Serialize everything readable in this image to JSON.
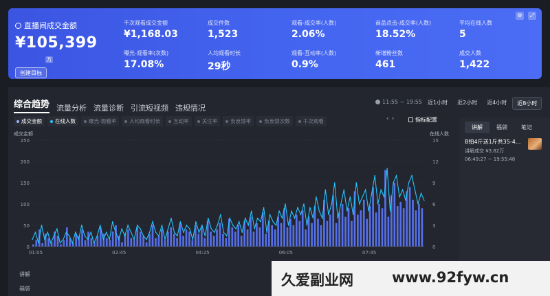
{
  "stats": {
    "icons": [
      "settings-icon",
      "expand-icon"
    ],
    "gmv_title": "直播间成交金额",
    "gmv_value": "¥105,399",
    "gmv_unit": "万",
    "target_button": "创建目标",
    "metrics": [
      {
        "label": "千次观看成交金额",
        "value": "¥1,168.03"
      },
      {
        "label": "成交件数",
        "value": "1,523"
      },
      {
        "label": "观看-成交率(人数)",
        "value": "2.06%"
      },
      {
        "label": "商品点击-成交率(人数)",
        "value": "18.52%"
      },
      {
        "label": "平均在线人数",
        "value": "5"
      },
      {
        "label": "曝光-观看率(次数)",
        "value": "17.08%"
      },
      {
        "label": "人均观看时长",
        "value": "29秒"
      },
      {
        "label": "观看-互动率(人数)",
        "value": "0.9%"
      },
      {
        "label": "新增粉丝数",
        "value": "461"
      },
      {
        "label": "成交人数",
        "value": "1,422"
      }
    ]
  },
  "tabs": [
    {
      "label": "综合趋势",
      "active": true
    },
    {
      "label": "流量分析"
    },
    {
      "label": "流量诊断"
    },
    {
      "label": "引流短视频"
    },
    {
      "label": "违规情况"
    }
  ],
  "time_range": "11:55 ~ 19:55",
  "periods": [
    {
      "label": "近1小时"
    },
    {
      "label": "近2小时"
    },
    {
      "label": "近4小时"
    },
    {
      "label": "近8小时",
      "active": true
    }
  ],
  "legend": [
    {
      "label": "成交金额",
      "on": true,
      "color": "#7f96ff"
    },
    {
      "label": "在线人数",
      "on": true,
      "color": "#26c6ff"
    },
    {
      "label": "曝光-观看率"
    },
    {
      "label": "人均观看时长"
    },
    {
      "label": "互动率"
    },
    {
      "label": "关注率"
    },
    {
      "label": "负反馈率"
    },
    {
      "label": "负反馈次数"
    },
    {
      "label": "千次观看"
    }
  ],
  "nav_arrows": [
    "‹",
    "›"
  ],
  "config_button": "指标配置",
  "chart_data": {
    "type": "bar",
    "left_axis_title": "成交金额",
    "right_axis_title": "在线人数",
    "y_left_ticks": [
      0,
      50,
      100,
      150,
      200,
      250
    ],
    "y_right_ticks": [
      0,
      3,
      6,
      9,
      12,
      15
    ],
    "ylim_left": [
      0,
      250
    ],
    "ylim_right": [
      0,
      15
    ],
    "x_ticks": [
      "01:05",
      "02:45",
      "04:25",
      "06:05",
      "07:45"
    ],
    "series": [
      {
        "name": "成交金额",
        "color": "#5b79ff",
        "values": [
          5,
          15,
          40,
          8,
          30,
          20,
          10,
          35,
          25,
          5,
          15,
          45,
          20,
          10,
          30,
          25,
          40,
          15,
          35,
          20,
          10,
          25,
          45,
          30,
          20,
          15,
          35,
          50,
          25,
          10,
          30,
          40,
          20,
          15,
          45,
          35,
          25,
          10,
          30,
          50,
          20,
          25,
          40,
          15,
          35,
          45,
          30,
          20,
          55,
          25,
          40,
          35,
          15,
          50,
          30,
          45,
          20,
          60,
          35,
          25,
          40,
          55,
          30,
          20,
          65,
          45,
          35,
          50,
          25,
          60,
          40,
          70,
          35,
          55,
          45,
          80,
          30,
          60,
          50,
          40,
          70,
          55,
          90,
          45,
          65,
          50,
          75,
          60,
          85,
          40,
          70,
          55,
          95,
          65,
          50,
          110,
          60,
          75,
          120,
          55,
          80,
          100,
          70,
          90,
          60,
          130,
          75,
          85,
          110,
          65,
          95,
          140,
          80,
          100,
          90,
          180,
          70,
          120,
          150,
          95,
          105,
          90,
          130,
          140,
          110,
          85,
          100,
          90
        ]
      },
      {
        "name": "在线人数",
        "color": "#26c6ff",
        "values": [
          1,
          2,
          0.5,
          3,
          1,
          2,
          0.5,
          1.5,
          2.5,
          0.5,
          1,
          2,
          1.5,
          0.5,
          2,
          1,
          3,
          1.5,
          1,
          2,
          0.5,
          1.5,
          3,
          1,
          2,
          1,
          3.5,
          2,
          1,
          2.5,
          1.5,
          3,
          2,
          1,
          3,
          2.5,
          1.5,
          1,
          2,
          3.5,
          2,
          1.5,
          3,
          1,
          2.5,
          4,
          2,
          1.5,
          3.5,
          2,
          3,
          2.5,
          1,
          3.5,
          2,
          3,
          1.5,
          4,
          2.5,
          2,
          3,
          4.5,
          2,
          1.5,
          4,
          3,
          2.5,
          3.5,
          2,
          4,
          3,
          5,
          2.5,
          4,
          3.5,
          5.5,
          2,
          4.5,
          3.5,
          3,
          5,
          4,
          6,
          3,
          5,
          4,
          5.5,
          4.5,
          6,
          3,
          5.5,
          4,
          7,
          5,
          4,
          8,
          4.5,
          6,
          9,
          4,
          6,
          8,
          5,
          7,
          4.5,
          9,
          6,
          7,
          8,
          5,
          7.5,
          10,
          6,
          8,
          7,
          11,
          5,
          9,
          10,
          7,
          8,
          6.5,
          9,
          10,
          8,
          6,
          7.5,
          6.5
        ]
      }
    ]
  },
  "side_panel": {
    "tabs": [
      {
        "label": "讲解",
        "active": true
      },
      {
        "label": "福袋"
      },
      {
        "label": "笔记"
      }
    ],
    "product_name": "B拍4斤送1斤共35-4...",
    "product_deal": "讲解成交 ¥3.82万",
    "product_time": "06:49:27 ~ 19:55:48"
  },
  "bottom_rows": [
    "讲解",
    "福袋"
  ],
  "watermark": {
    "left": "久爱副业网",
    "right": "www.92fyw.cn"
  }
}
